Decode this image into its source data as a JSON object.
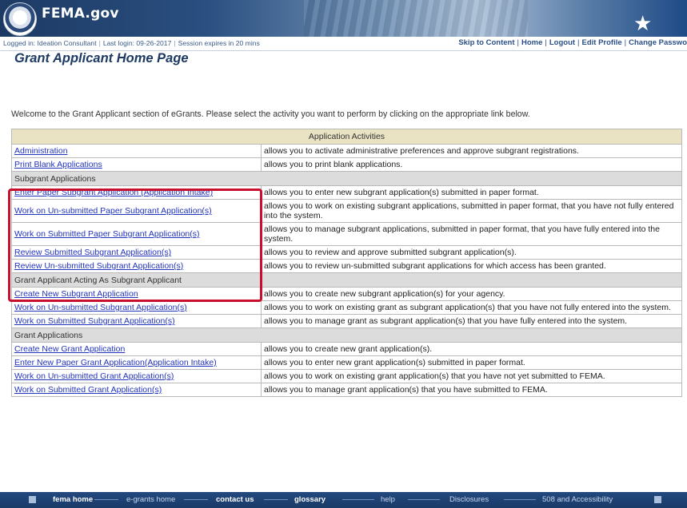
{
  "header": {
    "brand": "FEMA.gov",
    "seal_icon": "dhs-seal-icon",
    "star_icon": "star-icon"
  },
  "status_strip": {
    "logged_in": "Logged in: Ideation Consultant",
    "last_login": "Last login: 09-26-2017",
    "session": "Session expires in 20 mins",
    "nav": [
      "Skip to Content",
      "Home",
      "Logout",
      "Edit Profile",
      "Change Passwo"
    ]
  },
  "page": {
    "title": "Grant Applicant Home Page",
    "welcome": "Welcome to the Grant Applicant section of eGrants. Please select the activity you want to perform by clicking on the appropriate link below."
  },
  "table": {
    "header": "Application Activities",
    "rows": [
      {
        "link": "Administration",
        "desc": "allows you to activate administrative preferences and approve subgrant registrations."
      },
      {
        "link": "Print Blank Applications",
        "desc": "allows you to print blank applications."
      }
    ],
    "subgrant_section": "Subgrant Applications",
    "subgrant_rows": [
      {
        "link": "Enter Paper Subgrant Application (Application Intake)",
        "desc": "allows you to enter new subgrant application(s) submitted in paper format."
      },
      {
        "link": "Work on Un-submitted Paper Subgrant Application(s)",
        "desc": "allows you to work on existing subgrant applications, submitted in paper format, that you have not fully entered into the system."
      },
      {
        "link": "Work on Submitted Paper Subgrant Application(s)",
        "desc": "allows you to manage subgrant applications, submitted in paper format, that you have fully entered into the system."
      },
      {
        "link": "Review Submitted Subgrant Application(s)",
        "desc": "allows you to review and approve submitted subgrant application(s)."
      },
      {
        "link": "Review Un-submitted Subgrant Application(s)",
        "desc": "allows you to review un-submitted subgrant applications for which access has been granted."
      }
    ],
    "acting_section": "Grant Applicant Acting As Subgrant Applicant",
    "acting_rows": [
      {
        "link": "Create New Subgrant Application",
        "desc": "allows you to create new subgrant application(s) for your agency."
      },
      {
        "link": "Work on Un-submitted Subgrant Application(s)",
        "desc": "allows you to work on existing grant as subgrant application(s) that you have not fully entered into the system."
      },
      {
        "link": "Work on Submitted Subgrant Application(s)",
        "desc": "allows you to manage grant as subgrant application(s) that you have fully entered into the system."
      }
    ],
    "grant_section": "Grant Applications",
    "grant_rows": [
      {
        "link": "Create New Grant Application",
        "desc": "allows you to create new grant application(s)."
      },
      {
        "link": "Enter New Paper Grant Application(Application Intake)",
        "desc": "allows you to enter new grant application(s) submitted in paper format."
      },
      {
        "link": "Work on Un-submitted Grant Application(s)",
        "desc": "allows you to work on existing grant application(s) that you have not yet submitted to FEMA."
      },
      {
        "link": "Work on Submitted Grant Application(s)",
        "desc": "allows you to manage grant application(s) that you have submitted to FEMA."
      }
    ]
  },
  "footer": {
    "items": [
      "fema home",
      "e-grants home",
      "contact us",
      "glossary",
      "help",
      "Disclosures",
      "508 and Accessibility"
    ]
  },
  "colors": {
    "header_navy": "#1d3a63",
    "link_blue": "#2233bb",
    "highlight_red": "#c8102e",
    "table_header_bg": "#e9e3c4",
    "section_bg": "#dcdcdc"
  }
}
